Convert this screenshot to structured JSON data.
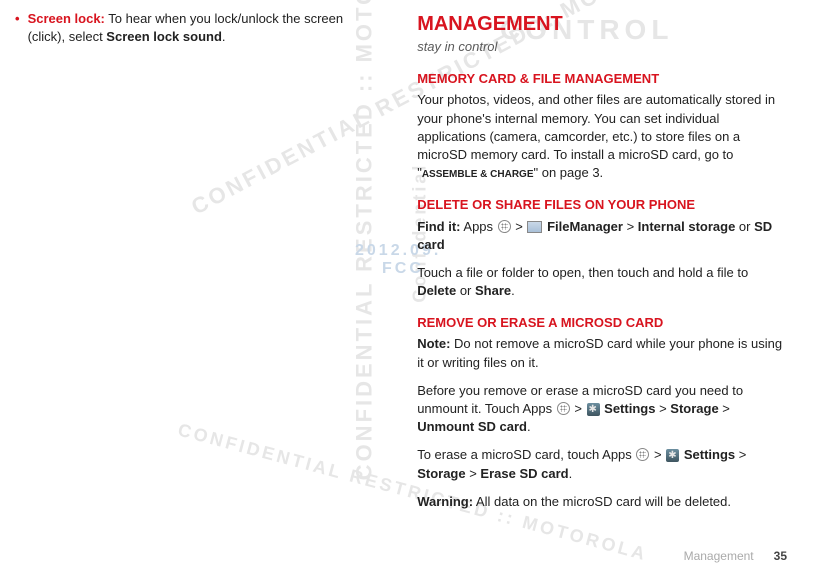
{
  "left": {
    "sl_label": "Screen lock:",
    "sl_text1": " To hear when you lock/unlock the screen (click), select ",
    "sl_bold": "Screen lock sound",
    "sl_dot": "."
  },
  "right": {
    "heading": "Management",
    "tagline": "stay in control",
    "mem_head": "Memory card & file management",
    "mem_p1": "Your photos, videos, and other files are automatically stored in your phone's internal memory. You can set individual applications (camera, camcorder, etc.) to store files on a microSD memory card. To install a microSD card, go to \"",
    "mem_asm": "Assemble & charge",
    "mem_p1b": "\" on page 3.",
    "del_head": "Delete or share files on your phone",
    "find_label": "Find it:",
    "find_apps": " Apps ",
    "find_gt1": " > ",
    "find_fm": " FileManager",
    "find_gt2": " > ",
    "find_int": "Internal storage",
    "find_or": " or ",
    "find_sd": "SD card",
    "touch_p": "Touch a file or folder to open, then touch and hold a file to ",
    "touch_del": "Delete",
    "touch_or": " or ",
    "touch_share": "Share",
    "touch_dot": ".",
    "rem_head": "Remove or erase a microSD card",
    "note_label": "Note:",
    "note_p": " Do not remove a microSD card while your phone is using it or writing files on it.",
    "before_p1": "Before you remove or erase a microSD card you need to unmount it. Touch Apps ",
    "gt": " > ",
    "settings": " Settings",
    "storage": "Storage",
    "unmount": "Unmount SD card",
    "erase_p1": "To erase a microSD card, touch Apps ",
    "erase_sd": "Erase SD card",
    "warn_label": "Warning:",
    "warn_p": " All data on the microSD card will be deleted.",
    "dot": "."
  },
  "footer": {
    "section": "Management",
    "page": "35"
  },
  "wm": {
    "conf": "Confidential",
    "date": "2012.09.",
    "fcc": "FCC",
    "controlled": "CONTROL",
    "restricted": "CONFIDENTIAL RESTRICTED :: MOTOROLA"
  }
}
